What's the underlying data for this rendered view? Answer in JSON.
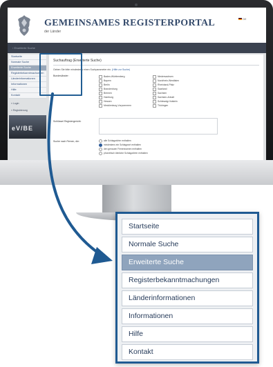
{
  "portal": {
    "title": "GEMEINSAMES REGISTERPORTAL",
    "subtitle": "der Länder",
    "language": "DE"
  },
  "breadcrumb": "› Erweiterte Suche",
  "sidebar": {
    "items": [
      {
        "label": "Startseite",
        "active": false
      },
      {
        "label": "Normale Suche",
        "active": false
      },
      {
        "label": "Erweiterte Suche",
        "active": true
      },
      {
        "label": "Registerbekanntmachungen",
        "active": false
      },
      {
        "label": "Länderinformationen",
        "active": false
      },
      {
        "label": "Informationen",
        "active": false
      },
      {
        "label": "Hilfe",
        "active": false
      },
      {
        "label": "Kontakt",
        "active": false
      }
    ],
    "login_label": "» Login",
    "register_label": "» Registrierung",
    "banner_text": "eV/BE"
  },
  "form": {
    "title": "Suchauftrag (Erweiterte Suche)",
    "intro": "Geben Sie bitte mindestens einen Suchparameter ein.",
    "intro_link": "(Hilfe zur Suche)",
    "bundeslaender_label": "Bundesländer:",
    "bundeslaender_col1": [
      "Baden-Württemberg",
      "Bayern",
      "Berlin",
      "Brandenburg",
      "Bremen",
      "Hamburg",
      "Hessen",
      "Mecklenburg-Vorpommern"
    ],
    "bundeslaender_col2": [
      "Niedersachsen",
      "Nordrhein-Westfalen",
      "Rheinland-Pfalz",
      "Saarland",
      "Sachsen",
      "Sachsen-Anhalt",
      "Schleswig-Holstein",
      "Thüringen"
    ],
    "registergericht_label": "Schlüssel Registergericht:",
    "suchoptionen_label": "Suche nach Firmen, die:",
    "suchoptionen": [
      {
        "label": "alle Schlagwörter enthalten",
        "selected": false
      },
      {
        "label": "mindestens ein Schlagwort enthalten",
        "selected": true
      },
      {
        "label": "den genauen Firmennamen enthalten",
        "selected": false
      },
      {
        "label": "phonetisch ähnliche Schlagwörter enthalten",
        "selected": false
      }
    ]
  },
  "zoom_menu": {
    "items": [
      {
        "label": "Startseite",
        "active": false
      },
      {
        "label": "Normale Suche",
        "active": false
      },
      {
        "label": "Erweiterte Suche",
        "active": true
      },
      {
        "label": "Registerbekanntmachungen",
        "active": false
      },
      {
        "label": "Länderinformationen",
        "active": false
      },
      {
        "label": "Informationen",
        "active": false
      },
      {
        "label": "Hilfe",
        "active": false
      },
      {
        "label": "Kontakt",
        "active": false
      }
    ]
  },
  "colors": {
    "accent": "#1f5a92",
    "menu_active_bg": "#8fa4bd",
    "menu_text": "#263b5a",
    "title_text": "#344a6b"
  }
}
